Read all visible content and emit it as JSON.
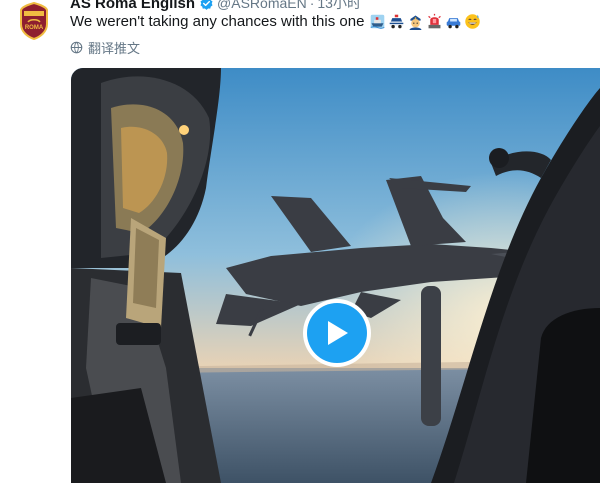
{
  "tweet": {
    "display_name": "AS Roma English",
    "handle": "@ASRomaEN",
    "separator": "·",
    "timestamp": "13小时",
    "text": "We weren't taking any chances with this one",
    "emojis": [
      "ship-icon",
      "police-car-icon",
      "police-officer-icon",
      "police-light-icon",
      "car-icon",
      "grinning-sweat-icon"
    ],
    "translate_label": "翻译推文",
    "avatar_crest_label": "ROMA"
  },
  "colors": {
    "accent": "#1da1f2",
    "text": "#14171a",
    "secondary": "#657786",
    "crest_red": "#8e1f2f",
    "crest_yellow": "#f0bc42"
  },
  "media": {
    "type": "video",
    "play_button": "play-icon"
  }
}
